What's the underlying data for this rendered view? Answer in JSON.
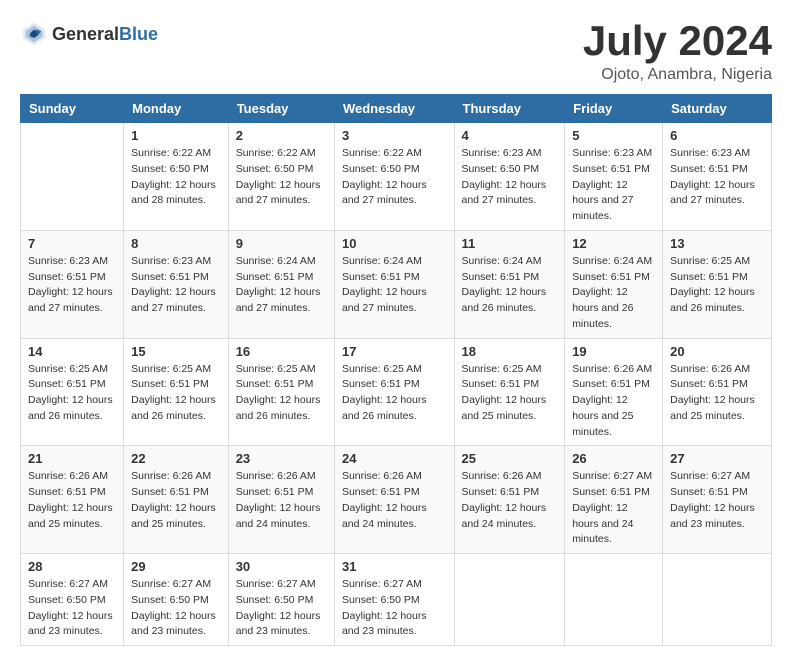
{
  "header": {
    "logo_general": "General",
    "logo_blue": "Blue",
    "month_title": "July 2024",
    "location": "Ojoto, Anambra, Nigeria"
  },
  "calendar": {
    "days_of_week": [
      "Sunday",
      "Monday",
      "Tuesday",
      "Wednesday",
      "Thursday",
      "Friday",
      "Saturday"
    ],
    "weeks": [
      [
        {
          "day": "",
          "sunrise": "",
          "sunset": "",
          "daylight": ""
        },
        {
          "day": "1",
          "sunrise": "Sunrise: 6:22 AM",
          "sunset": "Sunset: 6:50 PM",
          "daylight": "Daylight: 12 hours and 28 minutes."
        },
        {
          "day": "2",
          "sunrise": "Sunrise: 6:22 AM",
          "sunset": "Sunset: 6:50 PM",
          "daylight": "Daylight: 12 hours and 27 minutes."
        },
        {
          "day": "3",
          "sunrise": "Sunrise: 6:22 AM",
          "sunset": "Sunset: 6:50 PM",
          "daylight": "Daylight: 12 hours and 27 minutes."
        },
        {
          "day": "4",
          "sunrise": "Sunrise: 6:23 AM",
          "sunset": "Sunset: 6:50 PM",
          "daylight": "Daylight: 12 hours and 27 minutes."
        },
        {
          "day": "5",
          "sunrise": "Sunrise: 6:23 AM",
          "sunset": "Sunset: 6:51 PM",
          "daylight": "Daylight: 12 hours and 27 minutes."
        },
        {
          "day": "6",
          "sunrise": "Sunrise: 6:23 AM",
          "sunset": "Sunset: 6:51 PM",
          "daylight": "Daylight: 12 hours and 27 minutes."
        }
      ],
      [
        {
          "day": "7",
          "sunrise": "Sunrise: 6:23 AM",
          "sunset": "Sunset: 6:51 PM",
          "daylight": "Daylight: 12 hours and 27 minutes."
        },
        {
          "day": "8",
          "sunrise": "Sunrise: 6:23 AM",
          "sunset": "Sunset: 6:51 PM",
          "daylight": "Daylight: 12 hours and 27 minutes."
        },
        {
          "day": "9",
          "sunrise": "Sunrise: 6:24 AM",
          "sunset": "Sunset: 6:51 PM",
          "daylight": "Daylight: 12 hours and 27 minutes."
        },
        {
          "day": "10",
          "sunrise": "Sunrise: 6:24 AM",
          "sunset": "Sunset: 6:51 PM",
          "daylight": "Daylight: 12 hours and 27 minutes."
        },
        {
          "day": "11",
          "sunrise": "Sunrise: 6:24 AM",
          "sunset": "Sunset: 6:51 PM",
          "daylight": "Daylight: 12 hours and 26 minutes."
        },
        {
          "day": "12",
          "sunrise": "Sunrise: 6:24 AM",
          "sunset": "Sunset: 6:51 PM",
          "daylight": "Daylight: 12 hours and 26 minutes."
        },
        {
          "day": "13",
          "sunrise": "Sunrise: 6:25 AM",
          "sunset": "Sunset: 6:51 PM",
          "daylight": "Daylight: 12 hours and 26 minutes."
        }
      ],
      [
        {
          "day": "14",
          "sunrise": "Sunrise: 6:25 AM",
          "sunset": "Sunset: 6:51 PM",
          "daylight": "Daylight: 12 hours and 26 minutes."
        },
        {
          "day": "15",
          "sunrise": "Sunrise: 6:25 AM",
          "sunset": "Sunset: 6:51 PM",
          "daylight": "Daylight: 12 hours and 26 minutes."
        },
        {
          "day": "16",
          "sunrise": "Sunrise: 6:25 AM",
          "sunset": "Sunset: 6:51 PM",
          "daylight": "Daylight: 12 hours and 26 minutes."
        },
        {
          "day": "17",
          "sunrise": "Sunrise: 6:25 AM",
          "sunset": "Sunset: 6:51 PM",
          "daylight": "Daylight: 12 hours and 26 minutes."
        },
        {
          "day": "18",
          "sunrise": "Sunrise: 6:25 AM",
          "sunset": "Sunset: 6:51 PM",
          "daylight": "Daylight: 12 hours and 25 minutes."
        },
        {
          "day": "19",
          "sunrise": "Sunrise: 6:26 AM",
          "sunset": "Sunset: 6:51 PM",
          "daylight": "Daylight: 12 hours and 25 minutes."
        },
        {
          "day": "20",
          "sunrise": "Sunrise: 6:26 AM",
          "sunset": "Sunset: 6:51 PM",
          "daylight": "Daylight: 12 hours and 25 minutes."
        }
      ],
      [
        {
          "day": "21",
          "sunrise": "Sunrise: 6:26 AM",
          "sunset": "Sunset: 6:51 PM",
          "daylight": "Daylight: 12 hours and 25 minutes."
        },
        {
          "day": "22",
          "sunrise": "Sunrise: 6:26 AM",
          "sunset": "Sunset: 6:51 PM",
          "daylight": "Daylight: 12 hours and 25 minutes."
        },
        {
          "day": "23",
          "sunrise": "Sunrise: 6:26 AM",
          "sunset": "Sunset: 6:51 PM",
          "daylight": "Daylight: 12 hours and 24 minutes."
        },
        {
          "day": "24",
          "sunrise": "Sunrise: 6:26 AM",
          "sunset": "Sunset: 6:51 PM",
          "daylight": "Daylight: 12 hours and 24 minutes."
        },
        {
          "day": "25",
          "sunrise": "Sunrise: 6:26 AM",
          "sunset": "Sunset: 6:51 PM",
          "daylight": "Daylight: 12 hours and 24 minutes."
        },
        {
          "day": "26",
          "sunrise": "Sunrise: 6:27 AM",
          "sunset": "Sunset: 6:51 PM",
          "daylight": "Daylight: 12 hours and 24 minutes."
        },
        {
          "day": "27",
          "sunrise": "Sunrise: 6:27 AM",
          "sunset": "Sunset: 6:51 PM",
          "daylight": "Daylight: 12 hours and 23 minutes."
        }
      ],
      [
        {
          "day": "28",
          "sunrise": "Sunrise: 6:27 AM",
          "sunset": "Sunset: 6:50 PM",
          "daylight": "Daylight: 12 hours and 23 minutes."
        },
        {
          "day": "29",
          "sunrise": "Sunrise: 6:27 AM",
          "sunset": "Sunset: 6:50 PM",
          "daylight": "Daylight: 12 hours and 23 minutes."
        },
        {
          "day": "30",
          "sunrise": "Sunrise: 6:27 AM",
          "sunset": "Sunset: 6:50 PM",
          "daylight": "Daylight: 12 hours and 23 minutes."
        },
        {
          "day": "31",
          "sunrise": "Sunrise: 6:27 AM",
          "sunset": "Sunset: 6:50 PM",
          "daylight": "Daylight: 12 hours and 23 minutes."
        },
        {
          "day": "",
          "sunrise": "",
          "sunset": "",
          "daylight": ""
        },
        {
          "day": "",
          "sunrise": "",
          "sunset": "",
          "daylight": ""
        },
        {
          "day": "",
          "sunrise": "",
          "sunset": "",
          "daylight": ""
        }
      ]
    ]
  }
}
